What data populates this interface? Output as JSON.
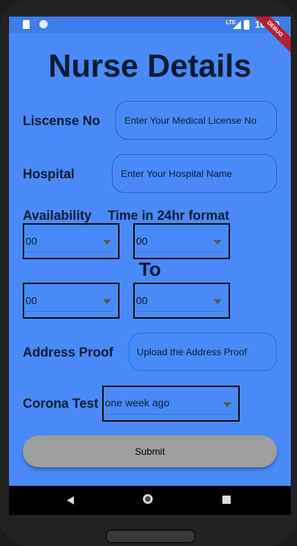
{
  "status_bar": {
    "time": "10:59",
    "network": "LTE",
    "debug_banner": "DEBUG"
  },
  "page": {
    "title": "Nurse Details"
  },
  "form": {
    "license": {
      "label": "Liscense No",
      "placeholder": "Enter Your Medical License No"
    },
    "hospital": {
      "label": "Hospital",
      "placeholder": "Enter Your Hospital Name"
    },
    "availability": {
      "label": "Availability",
      "hint": "Time in 24hr format",
      "from_hour": "00",
      "from_minute": "00",
      "to_label": "To",
      "to_hour": "00",
      "to_minute": "00"
    },
    "address_proof": {
      "label": "Address Proof",
      "button": "Upload the Address Proof"
    },
    "corona_test": {
      "label": "Corona Test",
      "selected": "one week ago"
    },
    "submit": "Submit"
  },
  "nav": {
    "back": "back-icon",
    "home": "home-icon",
    "recent": "recent-apps-icon"
  }
}
